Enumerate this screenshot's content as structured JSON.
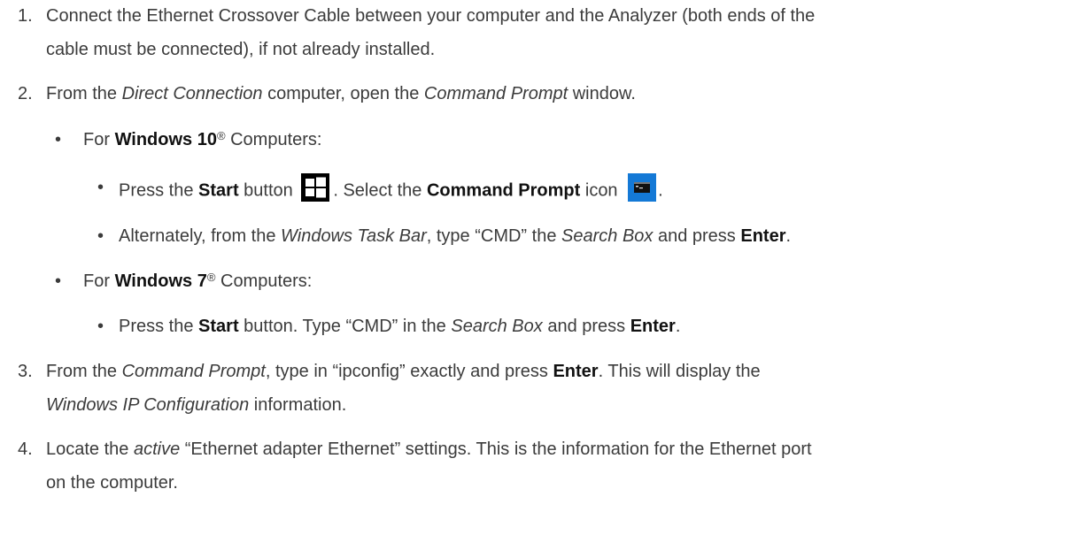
{
  "steps": [
    {
      "num": "1.",
      "line1": "Connect the Ethernet Crossover Cable between your computer and the Analyzer (both ends of the",
      "line2": "cable must be connected), if not already installed."
    },
    {
      "num": "2.",
      "t1": "From the ",
      "i1": "Direct Connection",
      "t2": " computer, open the ",
      "i2": "Command Prompt",
      "t3": " window."
    },
    {
      "num": "3.",
      "t1": "From the ",
      "i1": "Command Prompt",
      "t2": ", type in “ipconfig” exactly and press ",
      "b1": "Enter",
      "t3": ". This will display the",
      "i2": "Windows IP Configuration",
      "t4": " information."
    },
    {
      "num": "4.",
      "t1": "Locate the ",
      "i1": "active",
      "t2": " “Ethernet adapter Ethernet” settings. This is the information for the Ethernet port",
      "line2": "on the computer."
    }
  ],
  "win10": {
    "bullet": "•",
    "t1": "For ",
    "b1": "Windows 10",
    "sup": "®",
    "t2": " Computers:",
    "sub1": {
      "bullet": "•",
      "t1": "Press the ",
      "b1": "Start",
      "t2": " button ",
      "t3": ". Select the ",
      "b2": "Command Prompt",
      "t4": " icon ",
      "t5": ".",
      "start_icon": "windows-start-icon",
      "cmd_icon": "command-prompt-icon"
    },
    "sub2": {
      "bullet": "•",
      "t1": "Alternately, from the ",
      "i1": "Windows Task Bar",
      "t2": ", type “CMD” the ",
      "i2": "Search Box",
      "t3": " and press ",
      "b1": "Enter",
      "t4": "."
    }
  },
  "win7": {
    "bullet": "•",
    "t1": "For ",
    "b1": "Windows 7",
    "sup": "®",
    "t2": " Computers:",
    "sub1": {
      "bullet": "•",
      "t1": "Press the ",
      "b1": "Start",
      "t2": " button. Type “CMD” in the ",
      "i1": "Search Box",
      "t3": " and press ",
      "b2": "Enter",
      "t4": "."
    }
  }
}
